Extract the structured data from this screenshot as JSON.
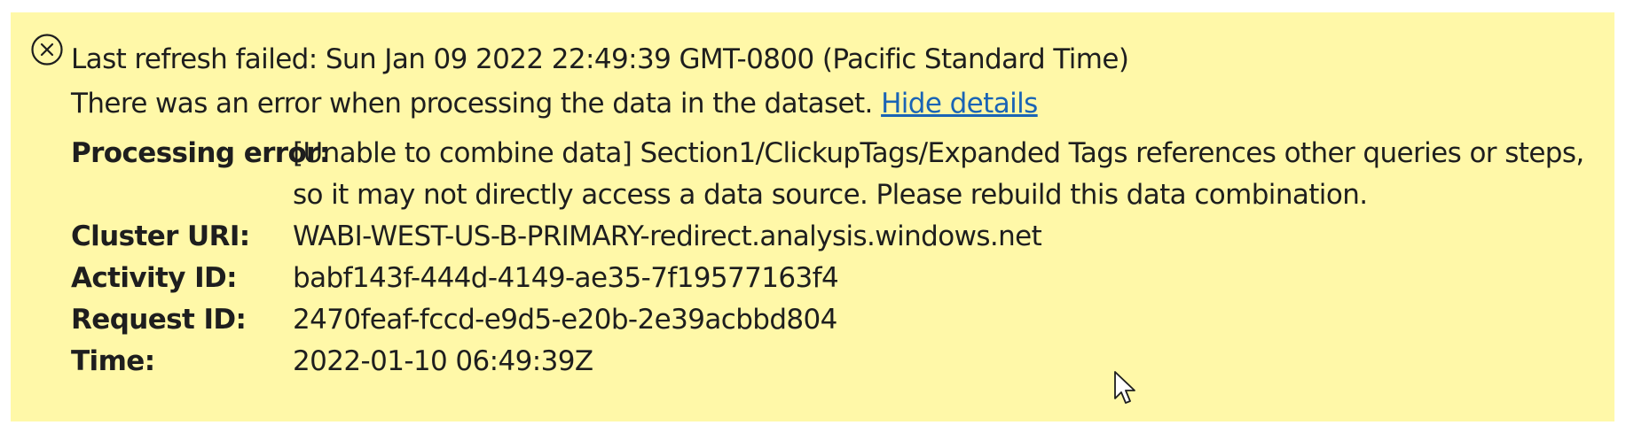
{
  "banner": {
    "background_color": "#fff8a8",
    "icon": "error-circle-x-icon",
    "headline": "Last refresh failed: Sun Jan 09 2022 22:49:39 GMT-0800 (Pacific Standard Time)",
    "message": "There was an error when processing the data in the dataset.",
    "toggle_link": "Hide details",
    "link_color": "#1a64b5"
  },
  "details": [
    {
      "key": "Processing error:",
      "value": "[Unable to combine data] Section1/ClickupTags/Expanded Tags references other queries or steps, so it may not directly access a data source. Please rebuild this data combination."
    },
    {
      "key": "Cluster URI:",
      "value": "WABI-WEST-US-B-PRIMARY-redirect.analysis.windows.net"
    },
    {
      "key": "Activity ID:",
      "value": "babf143f-444d-4149-ae35-7f19577163f4"
    },
    {
      "key": "Request ID:",
      "value": "2470feaf-fccd-e9d5-e20b-2e39acbbd804"
    },
    {
      "key": "Time:",
      "value": "2022-01-10 06:49:39Z"
    }
  ],
  "cursor": "arrow-pointer-icon"
}
